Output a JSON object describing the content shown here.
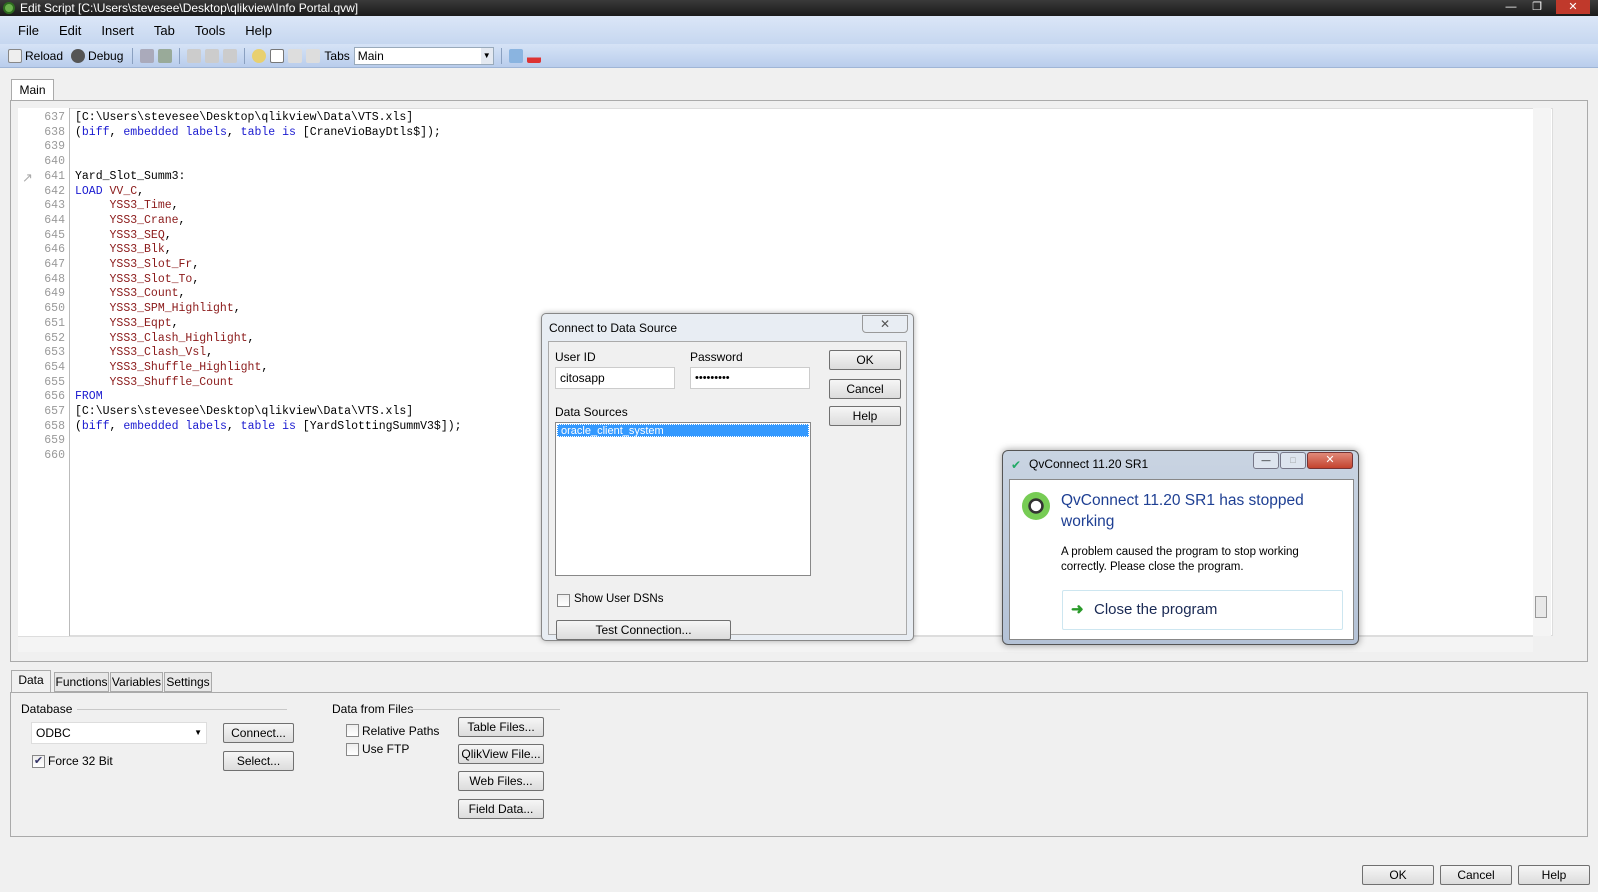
{
  "window": {
    "title": "Edit Script [C:\\Users\\stevesee\\Desktop\\qlikview\\Info Portal.qvw]",
    "min": "—",
    "max": "❐",
    "close": "✕"
  },
  "menu": [
    "File",
    "Edit",
    "Insert",
    "Tab",
    "Tools",
    "Help"
  ],
  "toolbar": {
    "reload": "Reload",
    "debug": "Debug",
    "tabs_label": "Tabs",
    "tabs_value": "Main"
  },
  "script_tab": "Main",
  "code": [
    {
      "num": "637",
      "parts": [
        {
          "c": "n",
          "t": "[C:\\Users\\stevesee\\Desktop\\qlikview\\Data\\VTS.xls]"
        }
      ]
    },
    {
      "num": "638",
      "parts": [
        {
          "c": "n",
          "t": "("
        },
        {
          "c": "k",
          "t": "biff"
        },
        {
          "c": "n",
          "t": ", "
        },
        {
          "c": "k",
          "t": "embedded labels"
        },
        {
          "c": "n",
          "t": ", "
        },
        {
          "c": "k",
          "t": "table is"
        },
        {
          "c": "n",
          "t": " [CraneVioBayDtls$]);"
        }
      ]
    },
    {
      "num": "639",
      "parts": []
    },
    {
      "num": "640",
      "parts": []
    },
    {
      "num": "641",
      "parts": [
        {
          "c": "n",
          "t": "Yard_Slot_Summ3:"
        }
      ]
    },
    {
      "num": "642",
      "parts": [
        {
          "c": "k",
          "t": "LOAD"
        },
        {
          "c": "n",
          "t": " "
        },
        {
          "c": "f",
          "t": "VV_C"
        },
        {
          "c": "n",
          "t": ","
        }
      ]
    },
    {
      "num": "643",
      "parts": [
        {
          "c": "n",
          "t": "     "
        },
        {
          "c": "f",
          "t": "YSS3_Time"
        },
        {
          "c": "n",
          "t": ","
        }
      ]
    },
    {
      "num": "644",
      "parts": [
        {
          "c": "n",
          "t": "     "
        },
        {
          "c": "f",
          "t": "YSS3_Crane"
        },
        {
          "c": "n",
          "t": ","
        }
      ]
    },
    {
      "num": "645",
      "parts": [
        {
          "c": "n",
          "t": "     "
        },
        {
          "c": "f",
          "t": "YSS3_SEQ"
        },
        {
          "c": "n",
          "t": ","
        }
      ]
    },
    {
      "num": "646",
      "parts": [
        {
          "c": "n",
          "t": "     "
        },
        {
          "c": "f",
          "t": "YSS3_Blk"
        },
        {
          "c": "n",
          "t": ","
        }
      ]
    },
    {
      "num": "647",
      "parts": [
        {
          "c": "n",
          "t": "     "
        },
        {
          "c": "f",
          "t": "YSS3_Slot_Fr"
        },
        {
          "c": "n",
          "t": ","
        }
      ]
    },
    {
      "num": "648",
      "parts": [
        {
          "c": "n",
          "t": "     "
        },
        {
          "c": "f",
          "t": "YSS3_Slot_To"
        },
        {
          "c": "n",
          "t": ","
        }
      ]
    },
    {
      "num": "649",
      "parts": [
        {
          "c": "n",
          "t": "     "
        },
        {
          "c": "f",
          "t": "YSS3_Count"
        },
        {
          "c": "n",
          "t": ","
        }
      ]
    },
    {
      "num": "650",
      "parts": [
        {
          "c": "n",
          "t": "     "
        },
        {
          "c": "f",
          "t": "YSS3_SPM_Highlight"
        },
        {
          "c": "n",
          "t": ","
        }
      ]
    },
    {
      "num": "651",
      "parts": [
        {
          "c": "n",
          "t": "     "
        },
        {
          "c": "f",
          "t": "YSS3_Eqpt"
        },
        {
          "c": "n",
          "t": ","
        }
      ]
    },
    {
      "num": "652",
      "parts": [
        {
          "c": "n",
          "t": "     "
        },
        {
          "c": "f",
          "t": "YSS3_Clash_Highlight"
        },
        {
          "c": "n",
          "t": ","
        }
      ]
    },
    {
      "num": "653",
      "parts": [
        {
          "c": "n",
          "t": "     "
        },
        {
          "c": "f",
          "t": "YSS3_Clash_Vsl"
        },
        {
          "c": "n",
          "t": ","
        }
      ]
    },
    {
      "num": "654",
      "parts": [
        {
          "c": "n",
          "t": "     "
        },
        {
          "c": "f",
          "t": "YSS3_Shuffle_Highlight"
        },
        {
          "c": "n",
          "t": ","
        }
      ]
    },
    {
      "num": "655",
      "parts": [
        {
          "c": "n",
          "t": "     "
        },
        {
          "c": "f",
          "t": "YSS3_Shuffle_Count"
        }
      ]
    },
    {
      "num": "656",
      "parts": [
        {
          "c": "k",
          "t": "FROM"
        }
      ]
    },
    {
      "num": "657",
      "parts": [
        {
          "c": "n",
          "t": "[C:\\Users\\stevesee\\Desktop\\qlikview\\Data\\VTS.xls]"
        }
      ]
    },
    {
      "num": "658",
      "parts": [
        {
          "c": "n",
          "t": "("
        },
        {
          "c": "k",
          "t": "biff"
        },
        {
          "c": "n",
          "t": ", "
        },
        {
          "c": "k",
          "t": "embedded labels"
        },
        {
          "c": "n",
          "t": ", "
        },
        {
          "c": "k",
          "t": "table is"
        },
        {
          "c": "n",
          "t": " [YardSlottingSummV3$]);"
        }
      ]
    },
    {
      "num": "659",
      "parts": []
    },
    {
      "num": "660",
      "parts": []
    }
  ],
  "connect_dialog": {
    "title": "Connect to Data Source",
    "close": "✕",
    "user_id_label": "User ID",
    "user_id": "citosapp",
    "password_label": "Password",
    "password": "•••••••••",
    "data_sources_label": "Data Sources",
    "data_sources": [
      "oracle_client_system"
    ],
    "show_user_dsns": "Show User DSNs",
    "test_connection": "Test Connection...",
    "ok": "OK",
    "cancel": "Cancel",
    "help": "Help"
  },
  "crash_dialog": {
    "title": "QvConnect 11.20 SR1",
    "heading": "QvConnect 11.20 SR1 has stopped working",
    "message": "A problem caused the program to stop working correctly. Please close the program.",
    "action": "Close the program",
    "min": "—",
    "max": "□",
    "close": "✕"
  },
  "bottom_tabs": [
    "Data",
    "Functions",
    "Variables",
    "Settings"
  ],
  "data_panel": {
    "database_label": "Database",
    "database_value": "ODBC",
    "force32": "Force 32 Bit",
    "connect": "Connect...",
    "select": "Select...",
    "files_label": "Data from Files",
    "relative_paths": "Relative Paths",
    "use_ftp": "Use FTP",
    "table_files": "Table Files...",
    "qlikview_file": "QlikView File...",
    "web_files": "Web Files...",
    "field_data": "Field Data..."
  },
  "footer": {
    "ok": "OK",
    "cancel": "Cancel",
    "help": "Help"
  }
}
